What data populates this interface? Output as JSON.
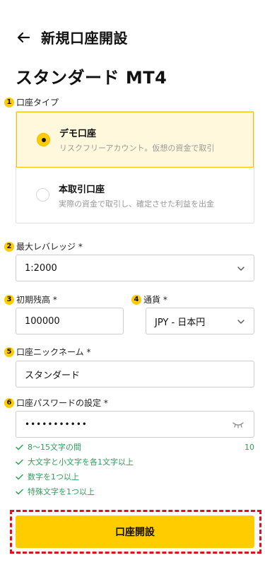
{
  "header": {
    "title": "新規口座開設",
    "back_icon": "arrow-left-icon"
  },
  "page_title": "スタンダード MT4",
  "account_type": {
    "badge": "1",
    "label": "口座タイプ",
    "selected": "demo",
    "options": [
      {
        "title": "デモ口座",
        "description": "リスクフリーアカウント。仮想の資金で取引"
      },
      {
        "title": "本取引口座",
        "description": "実際の資金で取引し、確定させた利益を出金"
      }
    ]
  },
  "leverage": {
    "badge": "2",
    "label": "最大レバレッジ *",
    "value": "1:2000"
  },
  "initial_balance": {
    "badge": "3",
    "label": "初期残高 *",
    "value": "100000"
  },
  "currency": {
    "badge": "4",
    "label": "通貨 *",
    "value": "JPY - 日本円"
  },
  "nickname": {
    "badge": "5",
    "label": "口座ニックネーム *",
    "value": "スタンダード"
  },
  "password": {
    "badge": "6",
    "label": "口座パスワードの設定 *",
    "value": "•••••••••••",
    "rules": [
      {
        "text": "8～15文字の間",
        "count": "10"
      },
      {
        "text": "大文字と小文字を各1文字以上"
      },
      {
        "text": "数字を1つ以上"
      },
      {
        "text": "特殊文字を1つ以上"
      }
    ]
  },
  "submit": {
    "label": "口座開設"
  },
  "colors": {
    "accent": "#ffcc00",
    "valid": "#2e9e5a",
    "highlight": "#e0101c"
  }
}
